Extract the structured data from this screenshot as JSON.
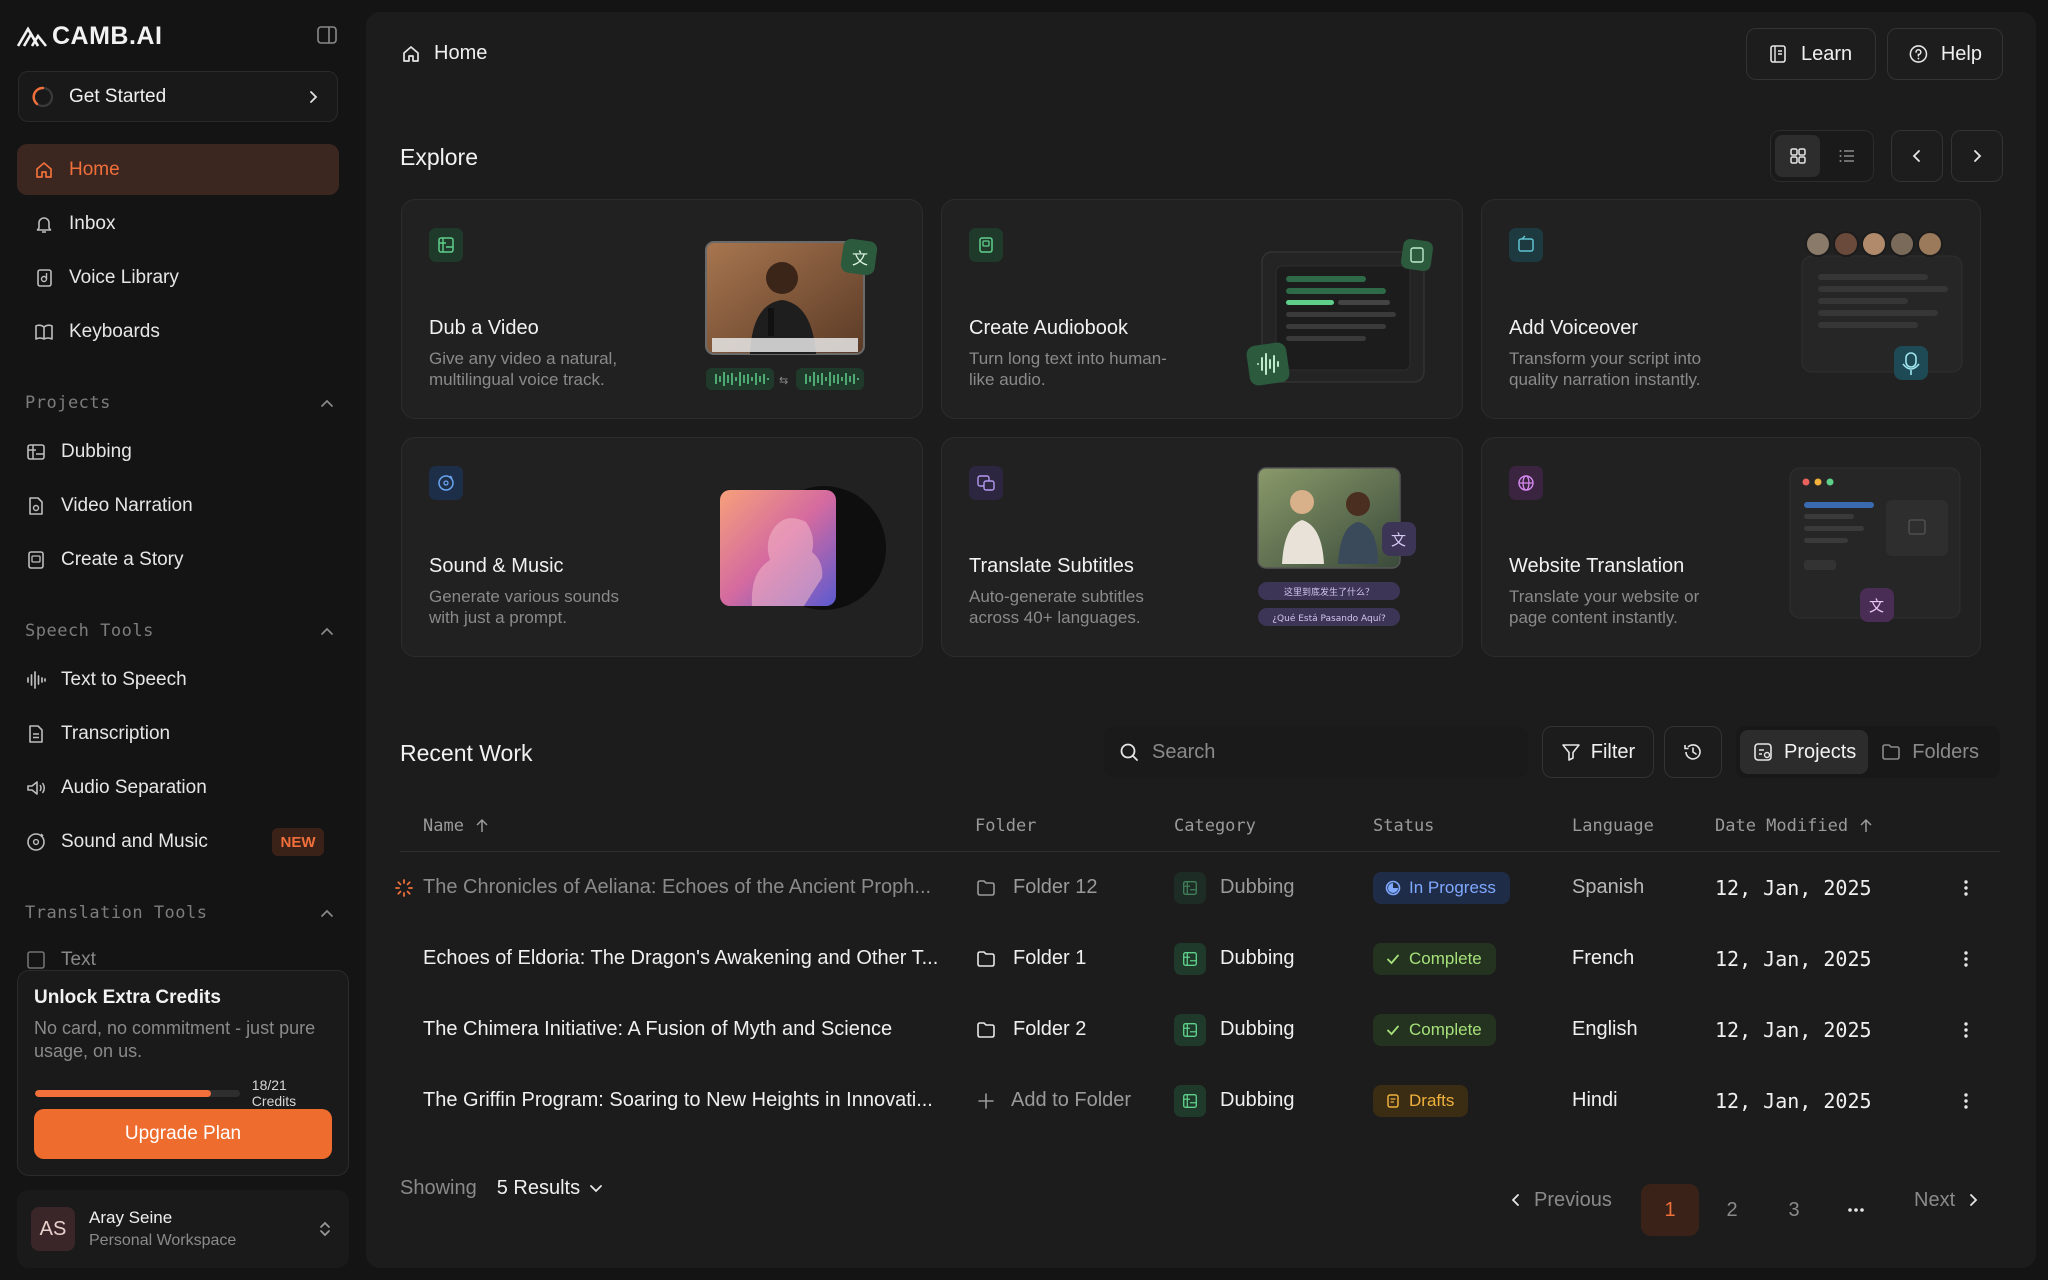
{
  "app": {
    "brand": "CAMB.AI"
  },
  "sidebar": {
    "get_started": "Get Started",
    "nav": [
      {
        "label": "Home",
        "icon": "home-icon",
        "active": true
      },
      {
        "label": "Inbox",
        "icon": "bell-icon"
      },
      {
        "label": "Voice Library",
        "icon": "voice-library-icon"
      },
      {
        "label": "Keyboards",
        "icon": "book-icon"
      }
    ],
    "projects_label": "Projects",
    "projects": [
      {
        "label": "Dubbing",
        "icon": "dubbing-icon"
      },
      {
        "label": "Video Narration",
        "icon": "narration-icon"
      },
      {
        "label": "Create a Story",
        "icon": "story-icon"
      }
    ],
    "speech_label": "Speech Tools",
    "speech": [
      {
        "label": "Text to Speech",
        "icon": "waveform-icon"
      },
      {
        "label": "Transcription",
        "icon": "document-icon"
      },
      {
        "label": "Audio Separation",
        "icon": "speaker-icon"
      },
      {
        "label": "Sound and Music",
        "icon": "music-icon",
        "badge": "NEW"
      }
    ],
    "translation_label": "Translation Tools",
    "translation": [
      {
        "label": "Text",
        "icon": "translate-icon"
      }
    ],
    "credits": {
      "title": "Unlock Extra Credits",
      "subtitle": "No card, no commitment - just pure usage, on us.",
      "used": 18,
      "total": 21,
      "count_label": "18/21 Credits",
      "upgrade": "Upgrade Plan"
    },
    "user": {
      "initials": "AS",
      "name": "Aray Seine",
      "workspace": "Personal Workspace"
    }
  },
  "header": {
    "breadcrumb": "Home",
    "learn": "Learn",
    "help": "Help"
  },
  "explore": {
    "title": "Explore",
    "cards": [
      {
        "title": "Dub a Video",
        "desc": "Give any video a natural, multilingual voice track."
      },
      {
        "title": "Create Audiobook",
        "desc": "Turn long text into human-like audio."
      },
      {
        "title": "Add Voiceover",
        "desc": "Transform your script into quality narration instantly."
      },
      {
        "title": "Sound & Music",
        "desc": "Generate various sounds with just a prompt."
      },
      {
        "title": "Translate Subtitles",
        "desc": "Auto-generate subtitles across 40+ languages."
      },
      {
        "title": "Website Translation",
        "desc": "Translate your website or page content instantly."
      }
    ],
    "subtitle_preview": [
      "这里到底发生了什么？",
      "¿Qué Está Pasando Aquí?"
    ]
  },
  "recent": {
    "title": "Recent Work",
    "search_placeholder": "Search",
    "filter": "Filter",
    "projects_tab": "Projects",
    "folders_tab": "Folders",
    "columns": [
      "Name",
      "Folder",
      "Category",
      "Status",
      "Language",
      "Date Modified"
    ],
    "rows": [
      {
        "name": "The Chronicles of Aeliana: Echoes of the Ancient Proph...",
        "folder": "Folder 12",
        "category": "Dubbing",
        "status": "In Progress",
        "language": "Spanish",
        "date": "12, Jan, 2025"
      },
      {
        "name": "Echoes of Eldoria: The Dragon's Awakening and Other T...",
        "folder": "Folder 1",
        "category": "Dubbing",
        "status": "Complete",
        "language": "French",
        "date": "12, Jan, 2025"
      },
      {
        "name": "The Chimera Initiative: A Fusion of Myth and Science",
        "folder": "Folder 2",
        "category": "Dubbing",
        "status": "Complete",
        "language": "English",
        "date": "12, Jan, 2025"
      },
      {
        "name": "The Griffin Program: Soaring to New Heights in Innovati...",
        "folder": "Add to Folder",
        "category": "Dubbing",
        "status": "Drafts",
        "language": "Hindi",
        "date": "12, Jan, 2025"
      }
    ],
    "showing": "Showing",
    "results": "5 Results",
    "previous": "Previous",
    "next": "Next",
    "pages": [
      "1",
      "2",
      "3"
    ],
    "current_page": "1"
  },
  "colors": {
    "accent": "#ef6c2f",
    "bg": "#141414",
    "panel": "#1c1c1c"
  }
}
